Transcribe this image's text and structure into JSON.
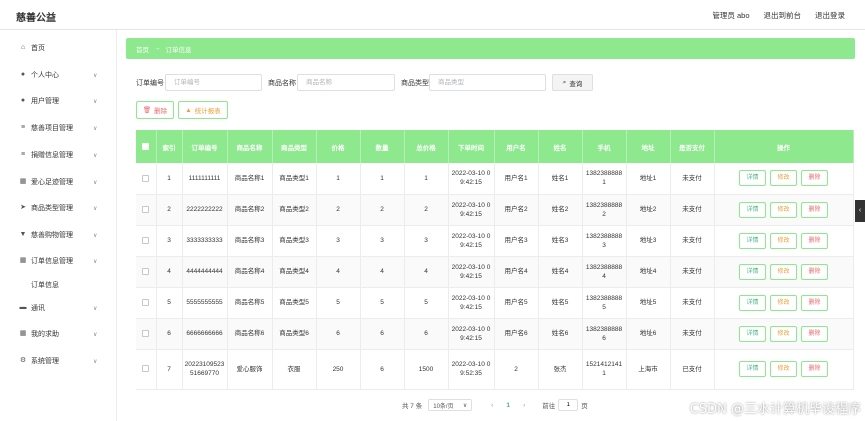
{
  "app": {
    "title": "慈善公益"
  },
  "header": {
    "admin_label": "管理员 abo",
    "front_label": "退出到前台",
    "logout_label": "退出登录"
  },
  "sidebar": {
    "items": [
      {
        "label": "首页",
        "icon": "home-icon"
      },
      {
        "label": "个人中心",
        "icon": "user-icon"
      },
      {
        "label": "用户管理",
        "icon": "user-icon"
      },
      {
        "label": "慈善项目管理",
        "icon": "list-icon"
      },
      {
        "label": "捐赠信息管理",
        "icon": "list-icon"
      },
      {
        "label": "爱心足迹管理",
        "icon": "grid-icon"
      },
      {
        "label": "商品类型管理",
        "icon": "send-icon"
      },
      {
        "label": "慈善购物管理",
        "icon": "shirt-icon"
      },
      {
        "label": "订单信息管理",
        "icon": "grid-icon"
      },
      {
        "label": "通讯",
        "icon": "chat-icon"
      },
      {
        "label": "我的求助",
        "icon": "grid-icon"
      },
      {
        "label": "系统管理",
        "icon": "gear-icon"
      }
    ],
    "sub_item": "订单信息"
  },
  "breadcrumb": {
    "home": "首页",
    "separator": "→",
    "current": "订单信息"
  },
  "filters": {
    "order_no_label": "订单编号",
    "order_no_placeholder": "订单编号",
    "product_name_label": "商品名称",
    "product_name_placeholder": "商品名称",
    "product_type_label": "商品类型",
    "product_type_placeholder": "商品类型",
    "search_label": "查询"
  },
  "actions": {
    "delete_label": "删除",
    "stats_label": "统计报表"
  },
  "table": {
    "headers": [
      "索引",
      "订单编号",
      "商品名称",
      "商品类型",
      "价格",
      "数量",
      "总价格",
      "下单时间",
      "用户名",
      "姓名",
      "手机",
      "地址",
      "是否支付",
      "操作"
    ],
    "rows": [
      [
        "1",
        "1111111111",
        "商品名称1",
        "商品类型1",
        "1",
        "1",
        "1",
        "2022-03-10 09:42:15",
        "用户名1",
        "姓名1",
        "13823888881",
        "地址1",
        "未支付"
      ],
      [
        "2",
        "2222222222",
        "商品名称2",
        "商品类型2",
        "2",
        "2",
        "2",
        "2022-03-10 09:42:15",
        "用户名2",
        "姓名2",
        "13823888882",
        "地址2",
        "未支付"
      ],
      [
        "3",
        "3333333333",
        "商品名称3",
        "商品类型3",
        "3",
        "3",
        "3",
        "2022-03-10 09:42:15",
        "用户名3",
        "姓名3",
        "13823888883",
        "地址3",
        "未支付"
      ],
      [
        "4",
        "4444444444",
        "商品名称4",
        "商品类型4",
        "4",
        "4",
        "4",
        "2022-03-10 09:42:15",
        "用户名4",
        "姓名4",
        "13823888884",
        "地址4",
        "未支付"
      ],
      [
        "5",
        "5555555555",
        "商品名称5",
        "商品类型5",
        "5",
        "5",
        "5",
        "2022-03-10 09:42:15",
        "用户名5",
        "姓名5",
        "13823888885",
        "地址5",
        "未支付"
      ],
      [
        "6",
        "6666666666",
        "商品名称6",
        "商品类型6",
        "6",
        "6",
        "6",
        "2022-03-10 09:42:15",
        "用户名6",
        "姓名6",
        "13823888886",
        "地址6",
        "未支付"
      ],
      [
        "7",
        "2022310952351669770",
        "爱心服饰",
        "衣服",
        "250",
        "6",
        "1500",
        "2022-03-10 09:52:35",
        "2",
        "张杰",
        "15214121411",
        "上海市",
        "已支付"
      ]
    ],
    "op_detail": "详情",
    "op_edit": "修改",
    "op_delete": "删除"
  },
  "pager": {
    "total": "共 7 条",
    "page_size": "10条/页",
    "current_page": "1",
    "goto_label": "前往",
    "goto_value": "1",
    "page_suffix": "页"
  },
  "watermark": "CSDN @三水计算机毕设程序",
  "colors": {
    "accent": "#8ee88e",
    "danger": "#e86b6b",
    "warning": "#e8a13a"
  }
}
